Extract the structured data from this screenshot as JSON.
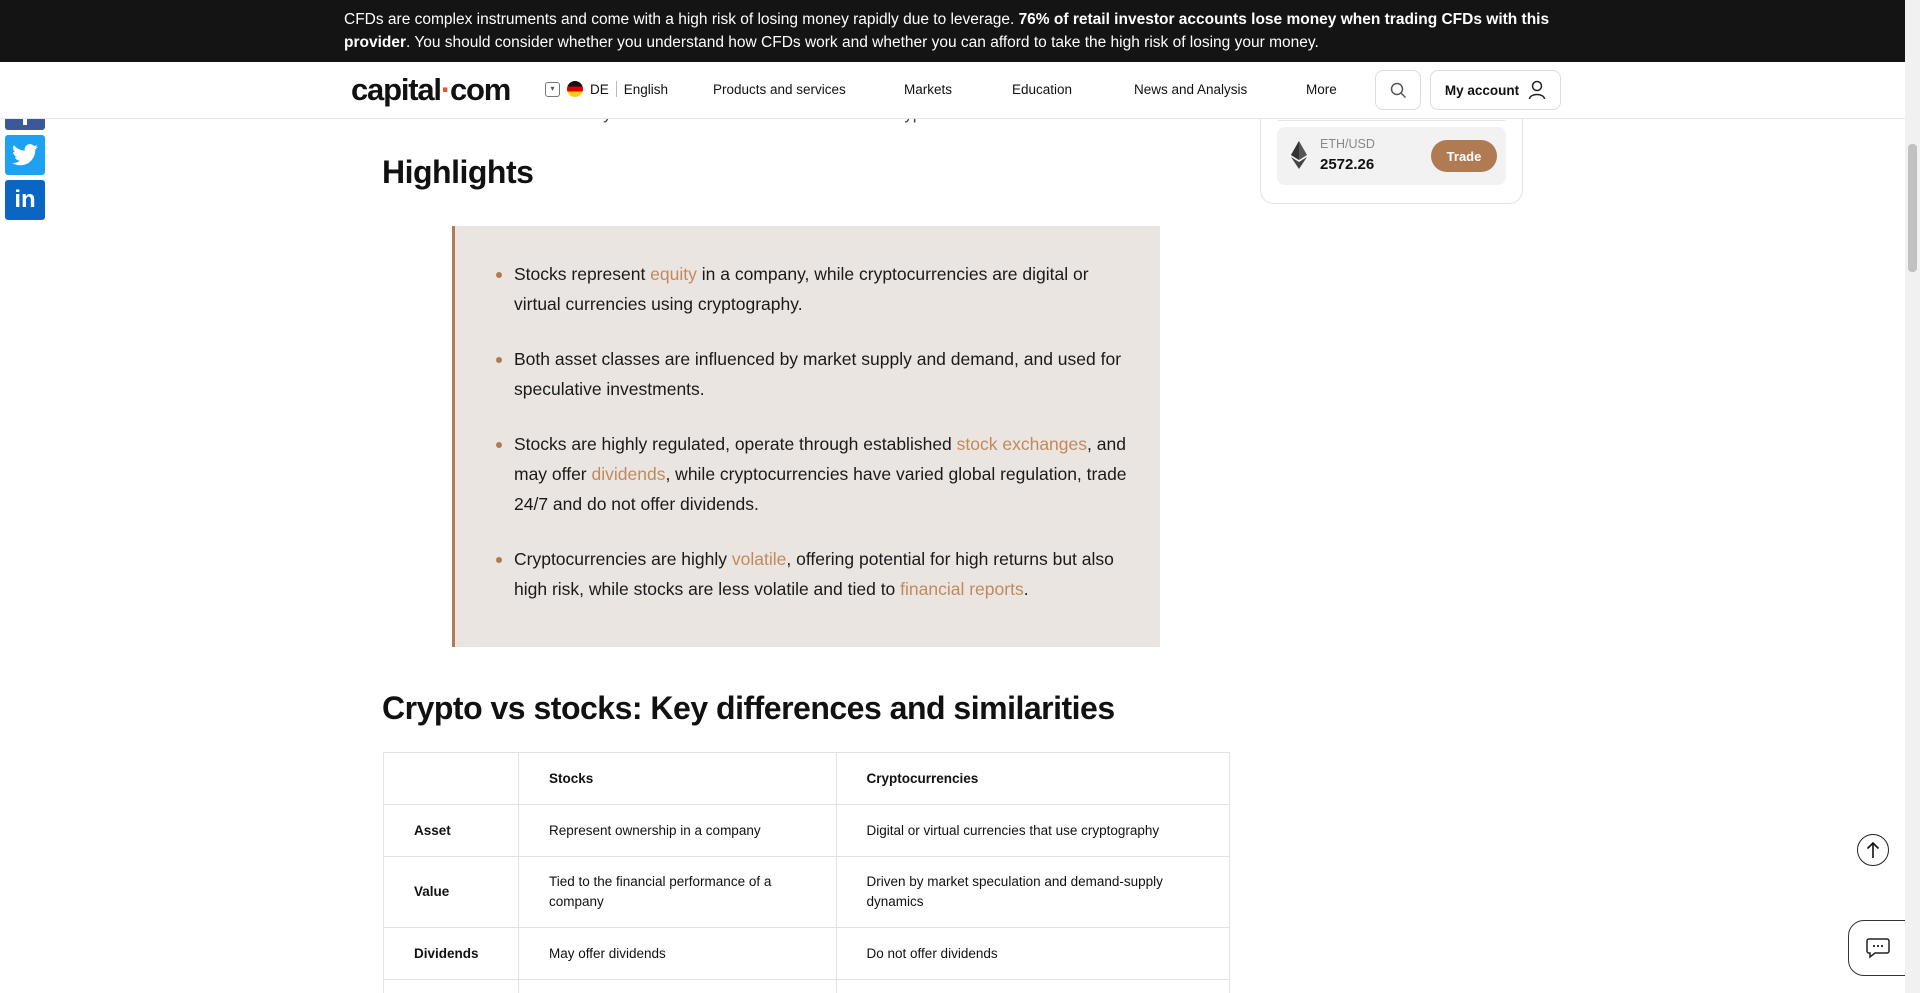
{
  "risk_banner": {
    "text_start": "CFDs are complex instruments and come with a high risk of losing money rapidly due to leverage. ",
    "text_bold": "76% of retail investor accounts lose money when trading CFDs with this provider",
    "text_end": ". You should consider whether you understand how CFDs work and whether you can afford to take the high risk of losing your money."
  },
  "header": {
    "logo_part1": "capital",
    "logo_dot": "·",
    "logo_part2": "com",
    "region_code": "DE",
    "language": "English",
    "nav": [
      "Products and services",
      "Markets",
      "Education",
      "News and Analysis",
      "More"
    ],
    "account_label": "My account"
  },
  "article": {
    "intro": "Here we take a look at the key similarities and differences between crypto and stocks.",
    "highlights_heading": "Highlights",
    "highlights": {
      "item1": {
        "a": "Stocks represent ",
        "link": "equity",
        "b": " in a company, while cryptocurrencies are digital or virtual currencies using cryptography."
      },
      "item2": {
        "a": "Both asset classes are influenced by market supply and demand, and used for speculative investments."
      },
      "item3": {
        "a": "Stocks are highly regulated, operate through established ",
        "link1": "stock exchanges",
        "b": ", and may offer ",
        "link2": "dividends",
        "c": ", while cryptocurrencies have varied global regulation, trade 24/7 and do not offer dividends."
      },
      "item4": {
        "a": "Cryptocurrencies are highly ",
        "link1": "volatile",
        "b": ", offering potential for high returns but also high risk, while stocks are less volatile and tied to ",
        "link2": "financial reports",
        "c": "."
      }
    },
    "comparison_heading": "Crypto vs stocks: Key differences and similarities",
    "table": {
      "headers": [
        "",
        "Stocks",
        "Cryptocurrencies"
      ],
      "rows": [
        [
          "Asset",
          "Represent ownership in a company",
          "Digital or virtual currencies that use cryptography"
        ],
        [
          "Value",
          "Tied to the financial performance of a company",
          "Driven by market speculation and demand-supply dynamics"
        ],
        [
          "Dividends",
          "May offer dividends",
          "Do not offer dividends"
        ]
      ]
    }
  },
  "sidebar": {
    "ticker": {
      "pair": "ETH/USD",
      "price": "2572.26",
      "trade_label": "Trade"
    }
  }
}
